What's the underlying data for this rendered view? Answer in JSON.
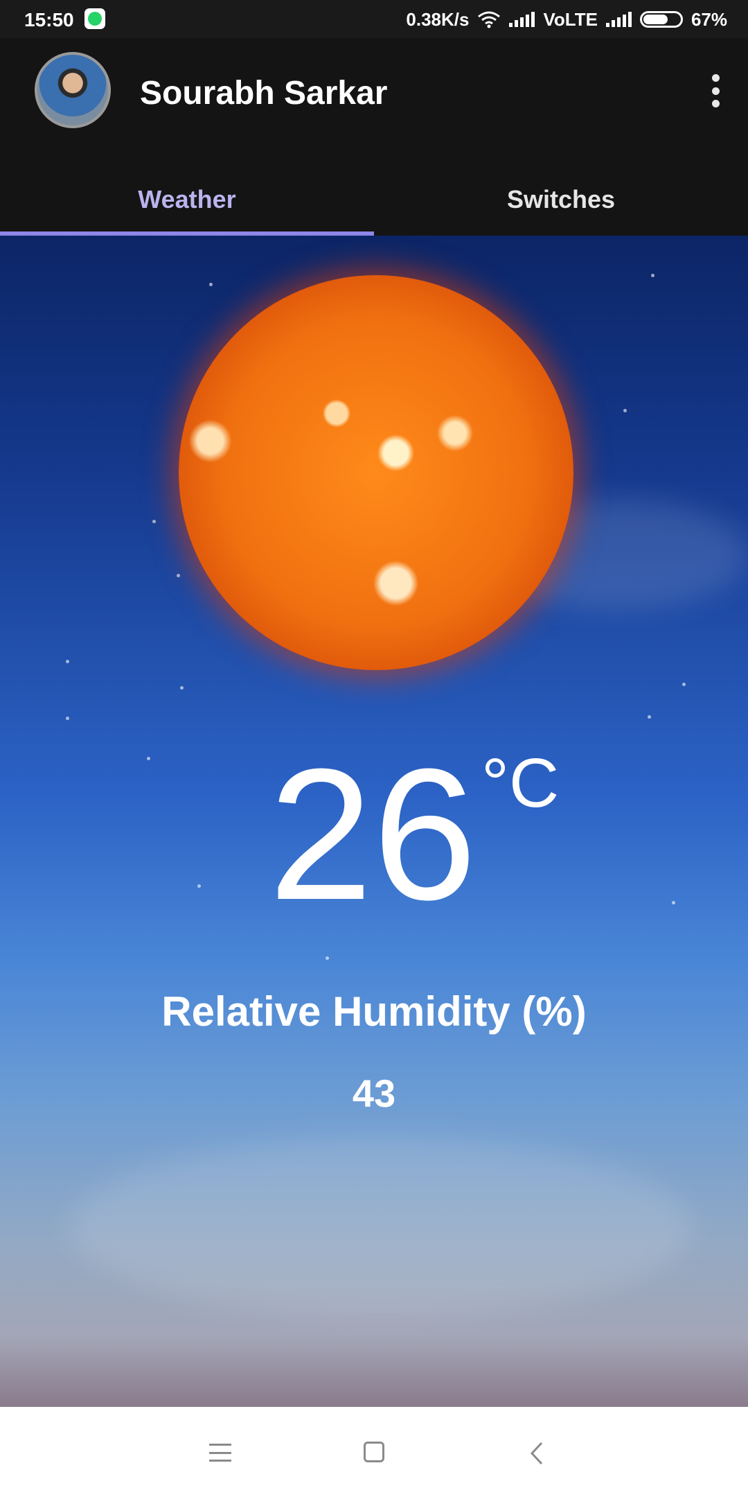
{
  "status_bar": {
    "time": "15:50",
    "network_speed": "0.38K/s",
    "network_type": "VoLTE",
    "battery": "67%",
    "battery_level": 0.67
  },
  "app_bar": {
    "user_name": "Sourabh Sarkar",
    "tabs": [
      {
        "label": "Weather",
        "active": true
      },
      {
        "label": "Switches",
        "active": false
      }
    ],
    "accent_color": "#8e86e8"
  },
  "weather": {
    "temperature": "26",
    "unit": "°C",
    "humidity_label": "Relative Humidity (%)",
    "humidity_value": "43"
  },
  "icons": {
    "status": [
      "whatsapp-icon",
      "wifi-icon",
      "signal-icon",
      "battery-icon"
    ],
    "app_bar": [
      "avatar",
      "more-vert-icon"
    ],
    "nav": [
      "menu-icon",
      "home-icon",
      "back-icon"
    ]
  }
}
